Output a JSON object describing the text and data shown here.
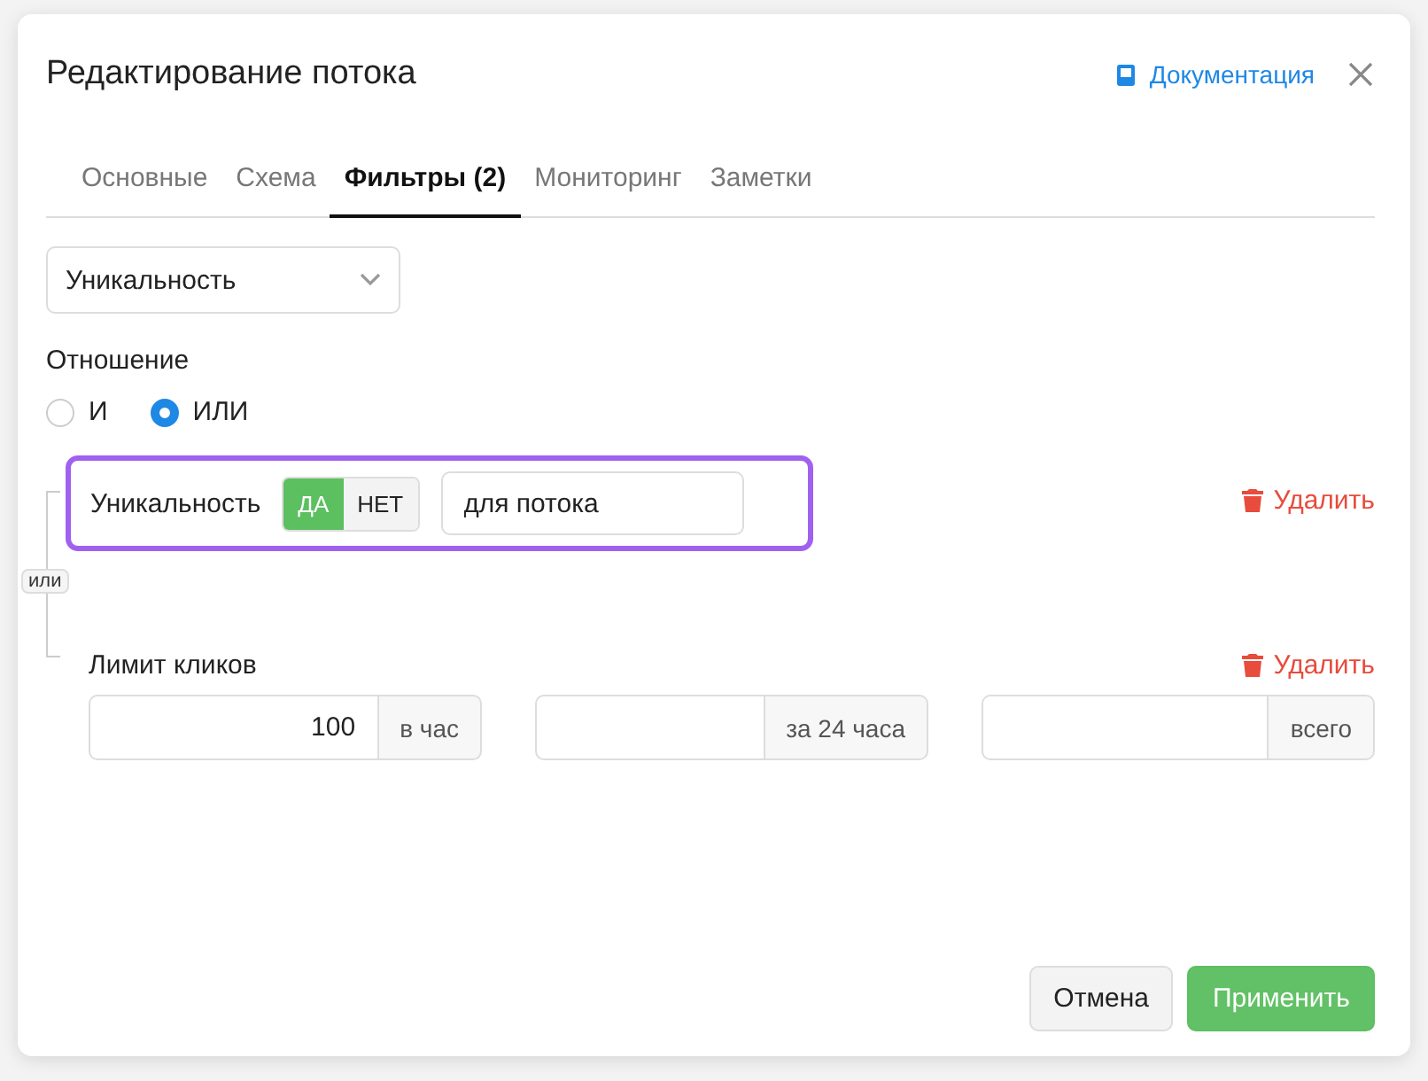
{
  "dialog": {
    "title": "Редактирование потока",
    "doc_link": "Документация"
  },
  "tabs": [
    {
      "label": "Основные",
      "selected": false
    },
    {
      "label": "Схема",
      "selected": false
    },
    {
      "label": "Фильтры (2)",
      "selected": true
    },
    {
      "label": "Мониторинг",
      "selected": false
    },
    {
      "label": "Заметки",
      "selected": false
    }
  ],
  "filter_select": {
    "value": "Уникальность"
  },
  "relation": {
    "label": "Отношение",
    "options": [
      {
        "label": "И",
        "selected": false
      },
      {
        "label": "ИЛИ",
        "selected": true
      }
    ],
    "connector": "или"
  },
  "filters": [
    {
      "kind": "toggle",
      "label": "Уникальность",
      "highlighted": true,
      "options": [
        {
          "label": "ДА",
          "selected": true
        },
        {
          "label": "НЕТ",
          "selected": false
        }
      ],
      "field": {
        "value": "для потока"
      },
      "delete": "Удалить"
    },
    {
      "kind": "limits",
      "label": "Лимит кликов",
      "highlighted": false,
      "fields": [
        {
          "value": "100",
          "addon": "в час"
        },
        {
          "addon": "за 24 часа"
        },
        {
          "addon": "всего"
        }
      ],
      "delete": "Удалить"
    }
  ],
  "buttons": {
    "cancel": "Отмена",
    "apply": "Применить"
  }
}
